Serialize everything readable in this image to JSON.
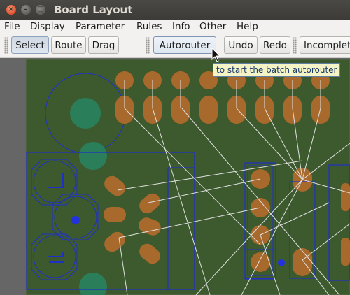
{
  "window": {
    "title": "Board Layout"
  },
  "menu": [
    "File",
    "Display",
    "Parameter",
    "Rules",
    "Info",
    "Other",
    "Help"
  ],
  "toolbar": {
    "select": "Select",
    "route": "Route",
    "drag": "Drag",
    "autorouter": "Autorouter",
    "undo": "Undo",
    "redo": "Redo",
    "incomplete": "Incomplete"
  },
  "tooltip": "to start the batch autorouter",
  "colors": {
    "board": "#3d5a2f",
    "pad": "#a86a2c",
    "outline": "#1f2fc8",
    "ratsnest": "#e0e0e0",
    "keepout": "#2a7f5a"
  }
}
